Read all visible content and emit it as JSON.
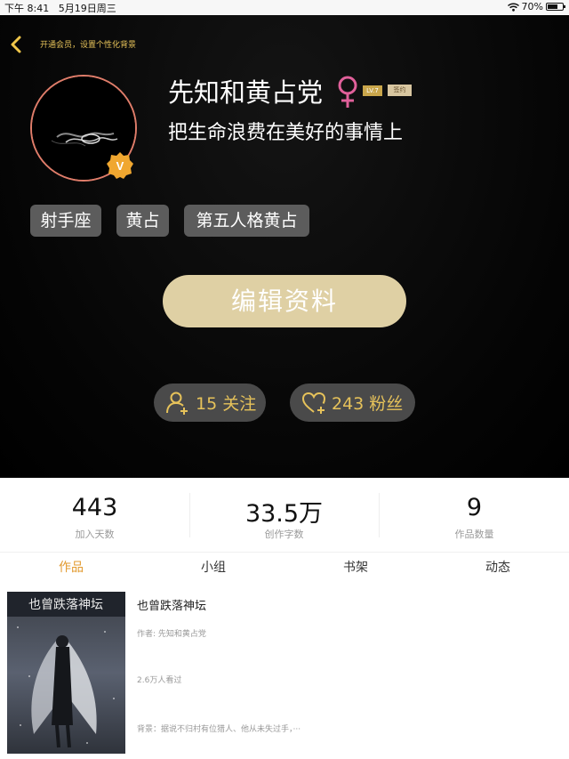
{
  "status_bar": {
    "time": "下午 8:41",
    "date": "5月19日周三",
    "battery": "70%",
    "battery_level": 0.7
  },
  "header": {
    "vip_link": "开通会员，设置个性化背景",
    "username": "先知和黄占党",
    "gender_symbol": "♀",
    "level_tag": "LV.7",
    "sign_tag": "签约",
    "motto": "把生命浪费在美好的事情上",
    "vip_badge": "V",
    "tags": [
      "射手座",
      "黄占",
      "第五人格黄占"
    ],
    "edit_button": "编辑资料",
    "follow_label": "15 关注",
    "fans_label": "243 粉丝"
  },
  "stats": [
    {
      "value": "443",
      "label": "加入天数"
    },
    {
      "value": "33.5万",
      "label": "创作字数"
    },
    {
      "value": "9",
      "label": "作品数量"
    }
  ],
  "tabs": [
    "作品",
    "小组",
    "书架",
    "动态"
  ],
  "active_tab": "作品",
  "work": {
    "title": "也曾跌落神坛",
    "author": "作者: 先知和黄占党",
    "views": "2.6万人看过",
    "description": "背景：据说不归村有位猎人、他从未失过手，···",
    "cover_title": "也曾跌落神坛"
  },
  "colors": {
    "accent": "#e29a2e",
    "gold": "#e6c25a",
    "edit_button": "#dfd0a4",
    "avatar_ring": "#e07d6a",
    "tag_bg": "#5c5c5c"
  }
}
